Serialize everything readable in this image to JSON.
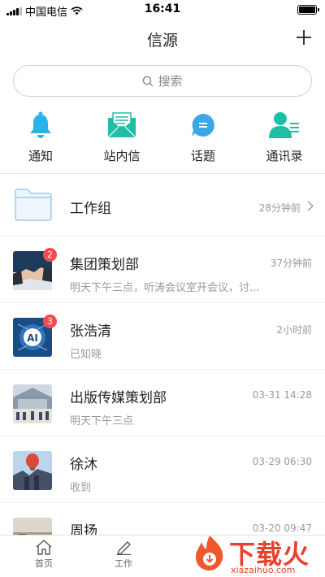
{
  "status_bar": {
    "carrier": "中国电信",
    "time": "16:41"
  },
  "header": {
    "title": "信源"
  },
  "search": {
    "placeholder": "搜索"
  },
  "quick_actions": [
    {
      "label": "通知",
      "icon": "bell-icon"
    },
    {
      "label": "站内信",
      "icon": "envelope-icon"
    },
    {
      "label": "话题",
      "icon": "chat-bubble-icon"
    },
    {
      "label": "通讯录",
      "icon": "contacts-icon"
    }
  ],
  "folder": {
    "name": "工作组",
    "time": "28分钟前"
  },
  "messages": [
    {
      "name": "集团策划部",
      "time": "37分钟前",
      "preview": "明天下午三点，听涛会议室开会议，讨...",
      "badge": "2"
    },
    {
      "name": "张浩清",
      "time": "2小时前",
      "preview": "已知晓",
      "badge": "3"
    },
    {
      "name": "出版传媒策划部",
      "time": "03-31 14:28",
      "preview": "明天下午三点"
    },
    {
      "name": "徐沐",
      "time": "03-29 06:30",
      "preview": "收到"
    },
    {
      "name": "周扬",
      "time": "03-20 09:47",
      "preview": ""
    }
  ],
  "tabbar": {
    "home": "首页",
    "work": "工作"
  },
  "watermark": {
    "text": "下载火",
    "sub": "xiazaihuo.com"
  },
  "colors": {
    "accent": "#1fbfc4",
    "badge": "#f24c4c",
    "chat_blue": "#3aa7e6"
  }
}
